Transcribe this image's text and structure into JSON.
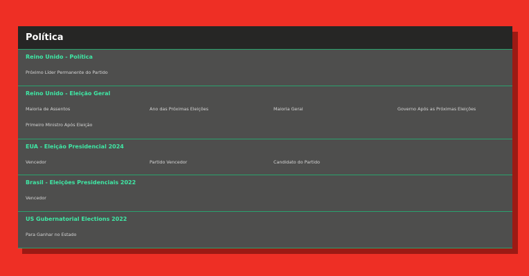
{
  "panel": {
    "title": "Política"
  },
  "sections": [
    {
      "title": "Reino Unido - Política",
      "markets": [
        "Próximo Líder Permanente do Partido"
      ]
    },
    {
      "title": "Reino Unido - Eleição Geral",
      "markets": [
        "Maioria de Assentos",
        "Ano das Próximas Eleições",
        "Maioria Geral",
        "Governo Após as Próximas Eleições",
        "Primeiro Ministro Após Eleição"
      ]
    },
    {
      "title": "EUA - Eleição Presidencial 2024",
      "markets": [
        "Vencedor",
        "Partido Vencedor",
        "Candidato do Partido"
      ]
    },
    {
      "title": "Brasil - Eleições Presidenciais 2022",
      "markets": [
        "Vencedor"
      ]
    },
    {
      "title": "US Gubernatorial Elections 2022",
      "markets": [
        "Para Ganhar no Estado"
      ]
    }
  ],
  "colors": {
    "background": "#ee2f25",
    "panel": "#4e4e4d",
    "header": "#262625",
    "accent": "#3fe8a5",
    "divider": "#2aa36e"
  }
}
